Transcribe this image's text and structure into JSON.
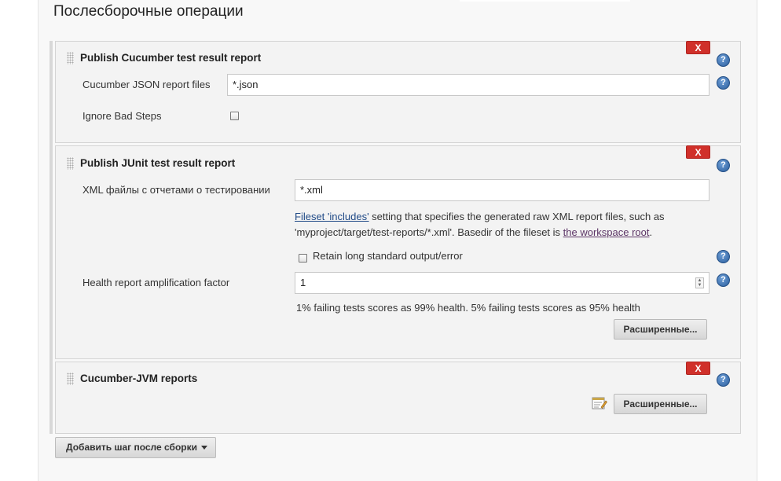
{
  "section": {
    "title": "Послесборочные операции"
  },
  "blocks": [
    {
      "title": "Publish Cucumber test result report",
      "delete_label": "X",
      "fields": {
        "json_label": "Cucumber JSON report files",
        "json_value": "*.json",
        "ignore_label": "Ignore Bad Steps",
        "ignore_checked": false
      }
    },
    {
      "title": "Publish JUnit test result report",
      "delete_label": "X",
      "fields": {
        "xml_label": "XML файлы с отчетами о тестировании",
        "xml_value": "*.xml",
        "desc_link1": "Fileset 'includes'",
        "desc_text1": " setting that specifies the generated raw XML report files, such as",
        "desc_text2": "'myproject/target/test-reports/*.xml'. Basedir of the fileset is ",
        "desc_link2": "the workspace root",
        "desc_text3": ".",
        "retain_label": "Retain long standard output/error",
        "retain_checked": false,
        "health_label": "Health report amplification factor",
        "health_value": "1",
        "health_hint": "1% failing tests scores as 99% health. 5% failing tests scores as 95% health",
        "advanced_label": "Расширенные..."
      }
    },
    {
      "title": "Cucumber-JVM reports",
      "delete_label": "X",
      "advanced_label": "Расширенные..."
    }
  ],
  "help_glyph": "?",
  "spinner": {
    "up": "▲",
    "down": "▼"
  },
  "add_step": {
    "label": "Добавить шаг после сборки"
  },
  "icons": [
    "help-icon",
    "notepad-icon",
    "drag-handle-icon",
    "dropdown-caret-icon"
  ],
  "colors": {
    "delete": "#d0302a",
    "help": "#2c5f9e",
    "link": "#204a87",
    "visited_link": "#5c3566"
  }
}
